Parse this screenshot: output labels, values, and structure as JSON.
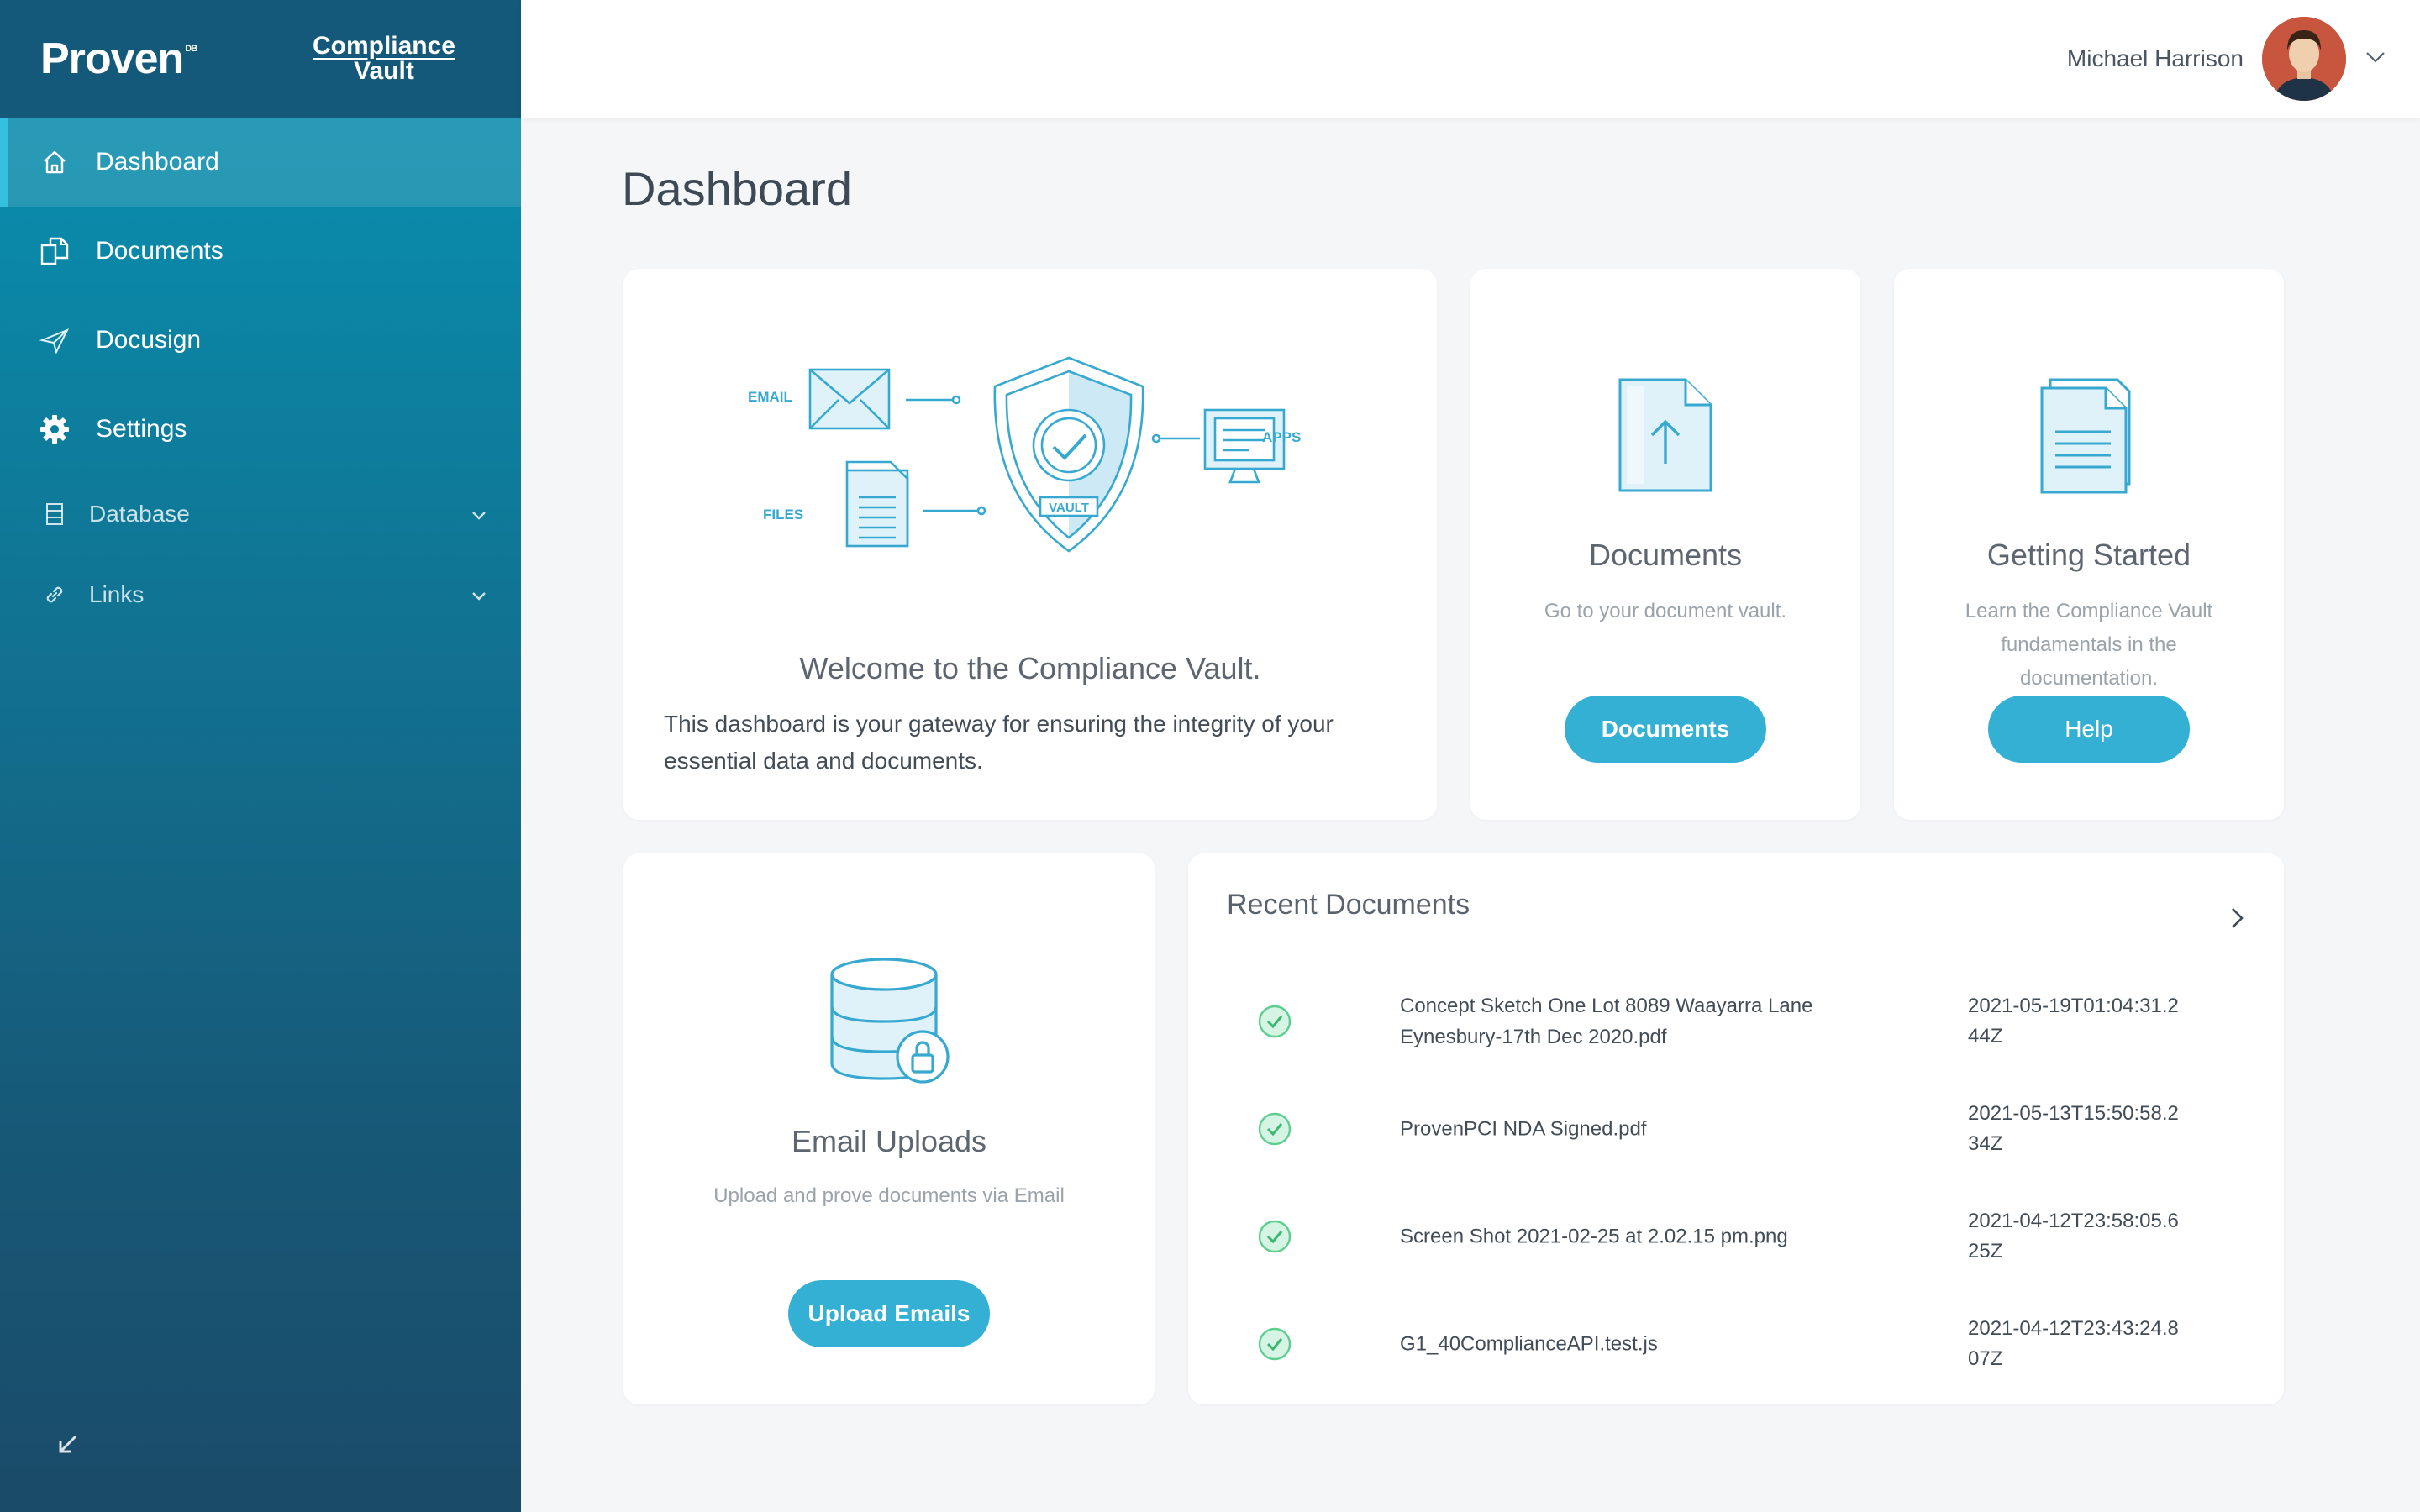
{
  "brand": {
    "logo": "Proven",
    "logo_super": "DB",
    "product_line1": "Compliance",
    "product_line2": "Vault"
  },
  "sidebar": {
    "items": [
      {
        "label": "Dashboard",
        "icon": "home-icon",
        "active": true
      },
      {
        "label": "Documents",
        "icon": "documents-icon"
      },
      {
        "label": "Docusign",
        "icon": "send-icon"
      },
      {
        "label": "Settings",
        "icon": "gear-icon"
      },
      {
        "label": "Database",
        "icon": "database-icon",
        "expandable": true
      },
      {
        "label": "Links",
        "icon": "link-icon",
        "expandable": true
      }
    ]
  },
  "user": {
    "name": "Michael Harrison"
  },
  "page": {
    "title": "Dashboard"
  },
  "welcome": {
    "illustration_labels": {
      "email": "EMAIL",
      "files": "FILES",
      "apps": "APPS",
      "vault": "VAULT"
    },
    "title": "Welcome to the Compliance Vault.",
    "body": "This dashboard is your gateway for ensuring the integrity of your essential data and documents."
  },
  "documents_card": {
    "title": "Documents",
    "subtitle": "Go to your document vault.",
    "button": "Documents"
  },
  "getting_started": {
    "title": "Getting Started",
    "subtitle": "Learn the Compliance Vault fundamentals in the documentation.",
    "button": "Help"
  },
  "email_uploads": {
    "title": "Email Uploads",
    "subtitle": "Upload and prove documents via Email",
    "button": "Upload Emails"
  },
  "recent": {
    "title": "Recent Documents",
    "rows": [
      {
        "name": "Concept Sketch One Lot 8089 Waayarra Lane Eynesbury-17th Dec 2020.pdf",
        "date": "2021-05-19T01:04:31.244Z",
        "status": "verified"
      },
      {
        "name": "ProvenPCI NDA Signed.pdf",
        "date": "2021-05-13T15:50:58.234Z",
        "status": "verified"
      },
      {
        "name": "Screen Shot 2021-02-25 at 2.02.15 pm.png",
        "date": "2021-04-12T23:58:05.625Z",
        "status": "verified"
      },
      {
        "name": "G1_40ComplianceAPI.test.js",
        "date": "2021-04-12T23:43:24.807Z",
        "status": "verified"
      }
    ]
  },
  "colors": {
    "accent": "#33b0d3",
    "sidebar_top": "#0a93b4",
    "sidebar_bottom": "#1a4b69",
    "check": "#5ccf8f"
  }
}
